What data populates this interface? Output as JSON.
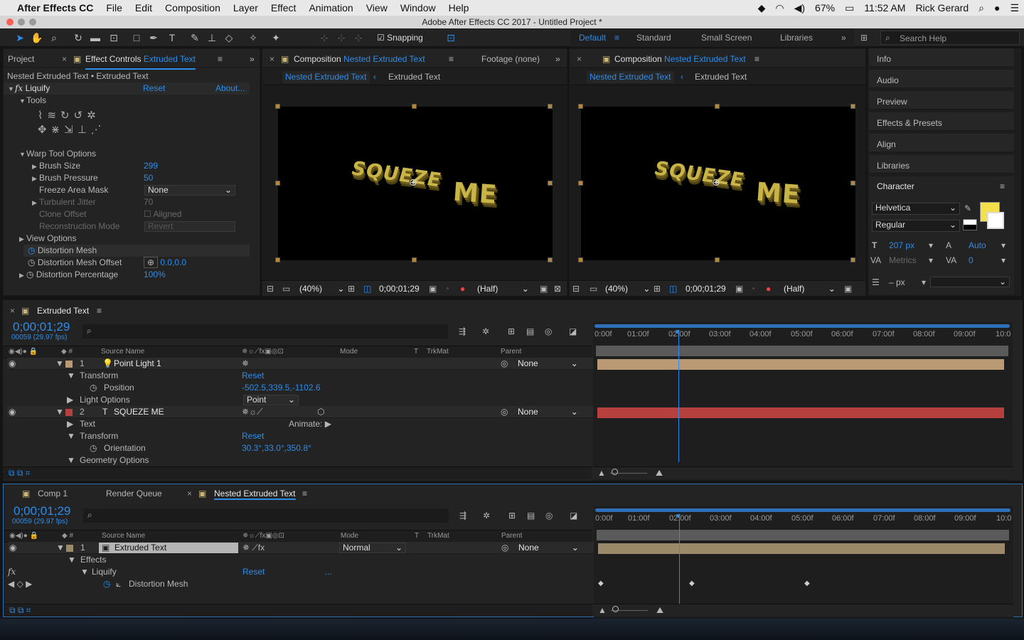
{
  "menubar": {
    "apple": "",
    "app": "After Effects CC",
    "items": [
      "File",
      "Edit",
      "Composition",
      "Layer",
      "Effect",
      "Animation",
      "View",
      "Window",
      "Help"
    ],
    "battery": "67%",
    "time": "11:52 AM",
    "user": "Rick Gerard"
  },
  "window": {
    "title": "Adobe After Effects CC 2017 - Untitled Project *"
  },
  "toolbar": {
    "snapping": "Snapping",
    "workspaces": [
      "Default",
      "Standard",
      "Small Screen",
      "Libraries"
    ],
    "search_placeholder": "Search Help"
  },
  "effects_panel": {
    "project_tab": "Project",
    "tab_prefix": "Effect Controls ",
    "tab_target": "Extruded Text",
    "breadcrumb": "Nested Extruded Text • Extruded Text",
    "effect_name": "Liquify",
    "reset": "Reset",
    "about": "About...",
    "tools_label": "Tools",
    "warp_options": "Warp Tool Options",
    "brush_size_label": "Brush Size",
    "brush_size": "299",
    "brush_pressure_label": "Brush Pressure",
    "brush_pressure": "50",
    "freeze_label": "Freeze Area Mask",
    "freeze_value": "None",
    "turbulent_label": "Turbulent Jitter",
    "turbulent_value": "70",
    "clone_label": "Clone Offset",
    "clone_value": "Aligned",
    "recon_label": "Reconstruction Mode",
    "recon_value": "Revert",
    "view_options": "View Options",
    "distortion_mesh": "Distortion Mesh",
    "mesh_offset_label": "Distortion Mesh Offset",
    "mesh_offset": "0.0,0.0",
    "distortion_pct_label": "Distortion Percentage",
    "distortion_pct": "100%"
  },
  "viewer_left": {
    "tab_prefix": "Composition ",
    "tab_target": "Nested Extruded Text",
    "footage_tab": "Footage (none)",
    "crumb_active": "Nested Extruded Text",
    "crumb_child": "Extruded Text",
    "text_a": "SQUEZE",
    "text_b": "ME",
    "zoom": "(40%)",
    "timecode": "0;00;01;29",
    "resolution": "(Half)"
  },
  "viewer_right": {
    "tab_prefix": "Composition ",
    "tab_target": "Nested Extruded Text",
    "crumb_active": "Nested Extruded Text",
    "crumb_child": "Extruded Text",
    "text_a": "SQUEZE",
    "text_b": "ME",
    "zoom": "(40%)",
    "timecode": "0;00;01;29",
    "resolution": "(Half)"
  },
  "right_panel": {
    "items": [
      "Info",
      "Audio",
      "Preview",
      "Effects & Presets",
      "Align",
      "Libraries"
    ],
    "character": {
      "title": "Character",
      "font": "Helvetica",
      "style": "Regular",
      "size": "207 px",
      "leading": "Auto",
      "kerning": "Metrics",
      "tracking": "0",
      "stroke": "– px"
    },
    "fill_color": "#f3e04b"
  },
  "timeline1": {
    "tab": "Extruded Text",
    "timecode": "0;00;01;29",
    "fps": "00059 (29.97 fps)",
    "headers": {
      "source": "Source Name",
      "mode": "Mode",
      "t": "T",
      "trkmat": "TrkMat",
      "parent": "Parent"
    },
    "ruler": [
      "0:00f",
      "01:00f",
      "02:00f",
      "03:00f",
      "04:00f",
      "05:00f",
      "06:00f",
      "07:00f",
      "08:00f",
      "09:00f",
      "10:0"
    ],
    "rows": [
      {
        "num": "1",
        "name": "Point Light 1",
        "parent": "None"
      },
      {
        "label": "Transform",
        "value": "Reset"
      },
      {
        "label": "Position",
        "value": "-502.5,339.5,-1102.6"
      },
      {
        "label": "Light Options",
        "value": "Point"
      },
      {
        "num": "2",
        "name": "SQUEZE ME",
        "parent": "None"
      },
      {
        "label": "Text",
        "value": "Animate:"
      },
      {
        "label": "Transform",
        "value": "Reset"
      },
      {
        "label": "Orientation",
        "value": "30.3°,33.0°,350.8°"
      },
      {
        "label": "Geometry Options",
        "value": ""
      }
    ],
    "layer_colors": [
      "#b99a74",
      "#b5403e"
    ]
  },
  "timeline2": {
    "tabs": [
      "Comp 1",
      "Render Queue",
      "Nested Extruded Text"
    ],
    "timecode": "0;00;01;29",
    "fps": "00059 (29.97 fps)",
    "headers": {
      "source": "Source Name",
      "mode": "Mode",
      "t": "T",
      "trkmat": "TrkMat",
      "parent": "Parent"
    },
    "ruler": [
      "0:00f",
      "01:00f",
      "02:00f",
      "03:00f",
      "04:00f",
      "05:00f",
      "06:00f",
      "07:00f",
      "08:00f",
      "09:00f",
      "10:0"
    ],
    "rows": [
      {
        "num": "1",
        "name": "Extruded Text",
        "mode": "Normal",
        "parent": "None"
      },
      {
        "label": "Effects"
      },
      {
        "label": "Liquify",
        "value": "Reset",
        "extra": "..."
      },
      {
        "label": "Distortion Mesh"
      }
    ],
    "layer_color": "#9a8a6a"
  }
}
